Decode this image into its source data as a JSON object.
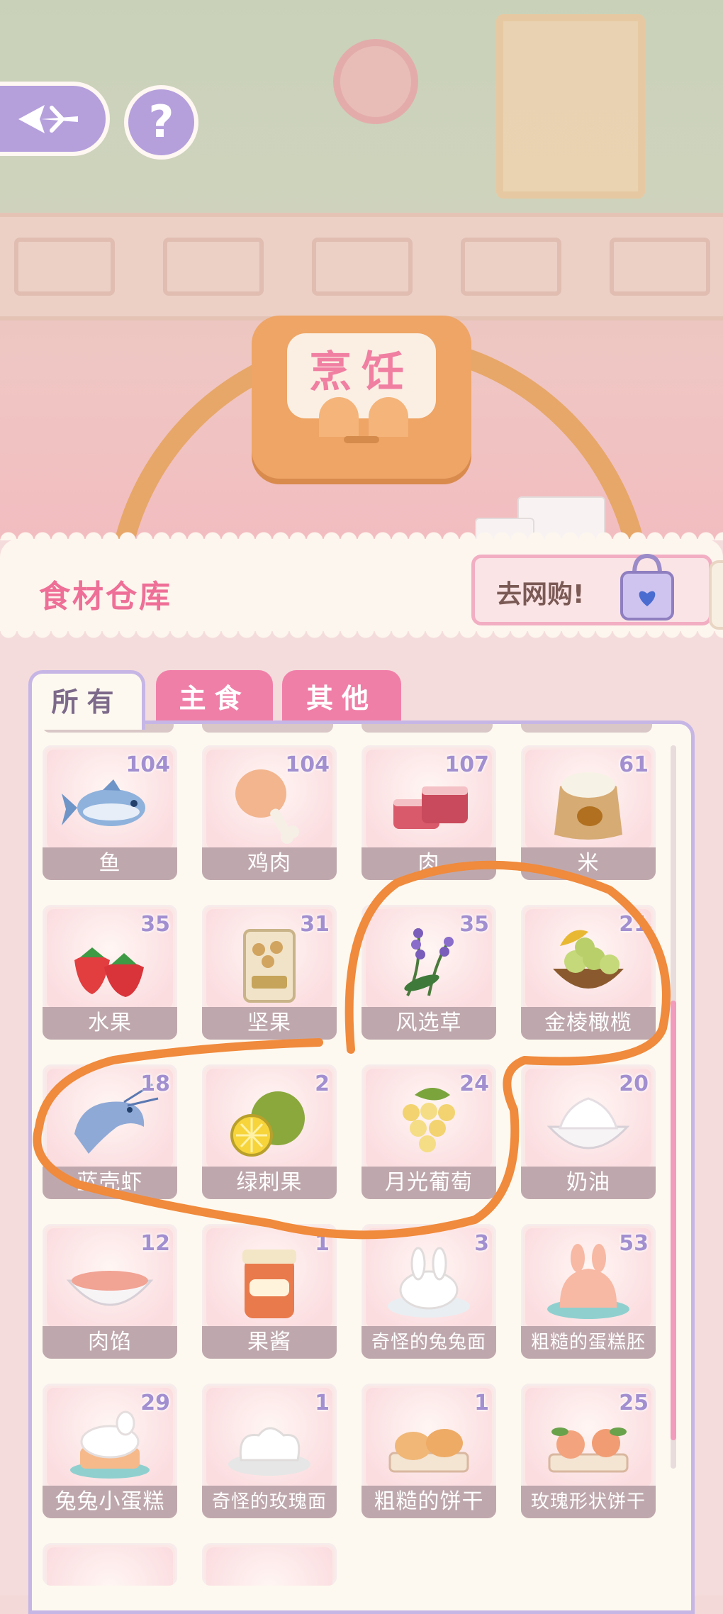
{
  "scene": {
    "sign_text": "烹饪"
  },
  "top_buttons": {
    "back_label": "",
    "help_label": "?"
  },
  "panel": {
    "title": "食材仓库",
    "shop_label": "去网购!"
  },
  "tabs": [
    {
      "label": "所有",
      "active": true
    },
    {
      "label": "主食",
      "active": false
    },
    {
      "label": "其他",
      "active": false
    }
  ],
  "items": [
    {
      "label": "鱼",
      "count": "104",
      "icon": "fish-icon"
    },
    {
      "label": "鸡肉",
      "count": "104",
      "icon": "chicken-leg-icon"
    },
    {
      "label": "肉",
      "count": "107",
      "icon": "meat-icon"
    },
    {
      "label": "米",
      "count": "61",
      "icon": "rice-sack-icon"
    },
    {
      "label": "水果",
      "count": "35",
      "icon": "strawberry-icon"
    },
    {
      "label": "坚果",
      "count": "31",
      "icon": "nuts-bag-icon"
    },
    {
      "label": "风选草",
      "count": "35",
      "icon": "lavender-herb-icon"
    },
    {
      "label": "金棱橄榄",
      "count": "21",
      "icon": "golden-olive-icon"
    },
    {
      "label": "蓝壳虾",
      "count": "18",
      "icon": "shrimp-icon"
    },
    {
      "label": "绿刺果",
      "count": "2",
      "icon": "spiky-fruit-icon"
    },
    {
      "label": "月光葡萄",
      "count": "24",
      "icon": "grape-icon"
    },
    {
      "label": "奶油",
      "count": "20",
      "icon": "cream-bowl-icon"
    },
    {
      "label": "肉馅",
      "count": "12",
      "icon": "minced-meat-bowl-icon"
    },
    {
      "label": "果酱",
      "count": "1",
      "icon": "jam-jar-icon"
    },
    {
      "label": "奇怪的兔兔面",
      "count": "3",
      "icon": "bunny-bread-icon"
    },
    {
      "label": "粗糙的蛋糕胚",
      "count": "53",
      "icon": "cake-base-icon"
    },
    {
      "label": "兔兔小蛋糕",
      "count": "29",
      "icon": "bunny-cake-icon"
    },
    {
      "label": "奇怪的玫瑰面",
      "count": "1",
      "icon": "rose-bread-icon"
    },
    {
      "label": "粗糙的饼干",
      "count": "1",
      "icon": "biscuit-icon"
    },
    {
      "label": "玫瑰形状饼干",
      "count": "25",
      "icon": "rose-cookie-icon"
    }
  ],
  "colors": {
    "accent_pink": "#ee6f97",
    "tab_pink": "#f07fa8",
    "border_lavender": "#c6b6e6",
    "annotation_orange": "#f08a3c"
  }
}
